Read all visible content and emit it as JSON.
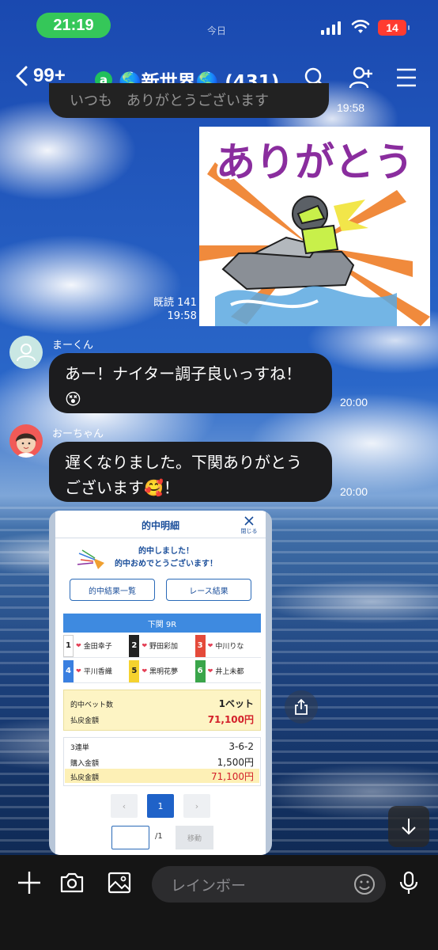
{
  "status_bar": {
    "time": "21:19",
    "battery": "14",
    "today_label": "今日"
  },
  "header": {
    "back_count": "99+",
    "official_badge": "a",
    "chat_title": "🌎新世界🌎 (431)",
    "icons": [
      "search-icon",
      "add-friend-icon",
      "menu-icon"
    ]
  },
  "messages": {
    "partial": {
      "text": "いつも　ありがとうございます",
      "time": "19:58"
    },
    "sticker": {
      "text": "ありがとう",
      "read_label": "既読 141",
      "time": "19:58",
      "colors": {
        "text": "#8a2d9e",
        "rays": "#f08a3c",
        "yellow": "#f2e64a"
      }
    },
    "msg1": {
      "sender": "まーくん",
      "line1": "あー！ナイター調子良いっすね！",
      "line2": "😵",
      "time": "20:00"
    },
    "msg2": {
      "sender": "おーちゃん",
      "line1": "遅くなりました。下関ありがとう",
      "line2": "ございます🥰！",
      "time": "20:00"
    }
  },
  "receipt": {
    "title": "的中明細",
    "close_label": "閉じる",
    "congrats_line1": "的中しました！",
    "congrats_line2": "的中おめでとうございます！",
    "btn_results": "的中結果一覧",
    "btn_race": "レース結果",
    "race": "下関 9R",
    "racers": [
      {
        "num": "1",
        "name": "金田幸子",
        "bg": "#ffffff",
        "fg": "#222222"
      },
      {
        "num": "2",
        "name": "野田彩加",
        "bg": "#222222",
        "fg": "#ffffff"
      },
      {
        "num": "3",
        "name": "中川りな",
        "bg": "#e44a3a",
        "fg": "#ffffff"
      },
      {
        "num": "4",
        "name": "平川香織",
        "bg": "#3a7fe0",
        "fg": "#ffffff"
      },
      {
        "num": "5",
        "name": "黒明花夢",
        "bg": "#f5d22e",
        "fg": "#222222"
      },
      {
        "num": "6",
        "name": "井上未都",
        "bg": "#3aa54a",
        "fg": "#ffffff"
      }
    ],
    "summary": {
      "bets_label": "的中ベット数",
      "bets_value": "1ベット",
      "payout_label": "払戻金額",
      "payout_value": "71,100円"
    },
    "detail": {
      "type_label": "3連単",
      "combo": "3-6-2",
      "purchase_label": "購入金額",
      "purchase_value": "1,500円",
      "payout_label": "払戻金額",
      "payout_value": "71,100円"
    },
    "pagination": {
      "prev": "‹",
      "current": "1",
      "next": "›",
      "total": "/1",
      "move_label": "移動"
    }
  },
  "input_bar": {
    "placeholder": "レインボー"
  }
}
